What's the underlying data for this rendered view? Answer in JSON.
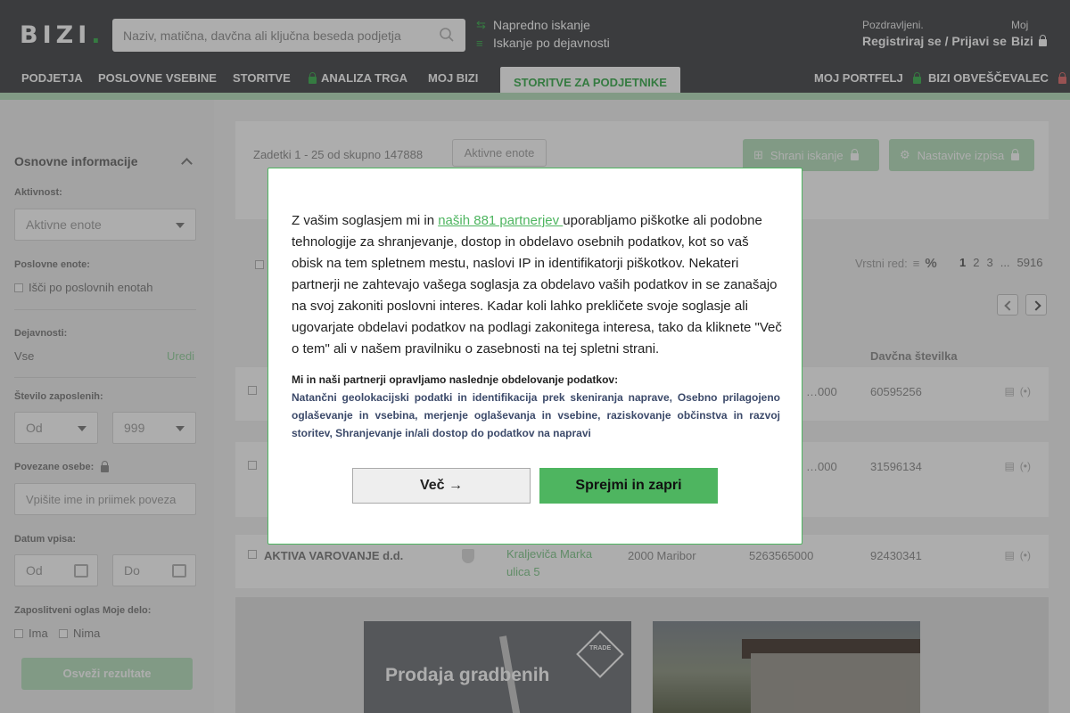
{
  "header": {
    "logo": "BIZI",
    "search_placeholder": "Naziv, matična, davčna ali ključna beseda podjetja",
    "advanced_search": "Napredno iskanje",
    "activity_search": "Iskanje po dejavnosti",
    "greeting": "Pozdravljeni.",
    "login": "Registriraj se / Prijavi se",
    "moj_small": "Moj",
    "moj_big": "Bizi"
  },
  "nav": {
    "items": [
      "PODJETJA",
      "POSLOVNE VSEBINE",
      "STORITVE",
      "ANALIZA TRGA",
      "MOJ BIZI",
      "STORITVE ZA PODJETNIKE"
    ],
    "right": [
      "MOJ PORTFELJ",
      "BIZI OBVEŠČEVALEC"
    ]
  },
  "sidebar": {
    "title": "Osnovne informacije",
    "aktivnost_label": "Aktivnost:",
    "aktivnost_value": "Aktivne enote",
    "poslovne_label": "Poslovne enote:",
    "poslovne_cb": "Išči po poslovnih enotah",
    "dejavnosti_label": "Dejavnosti:",
    "dejavnosti_value": "Vse",
    "dejavnosti_edit": "Uredi",
    "zaposleni_label": "Število zaposlenih:",
    "od": "Od",
    "do_value": "999",
    "osebe_label": "Povezane osebe:",
    "osebe_placeholder": "Vpišite ime in priimek poveza",
    "datum_label": "Datum vpisa:",
    "datum_od": "Od",
    "datum_do": "Do",
    "oglas_label": "Zaposlitveni oglas Moje delo:",
    "ima": "Ima",
    "nima": "Nima",
    "refresh": "Osveži rezultate"
  },
  "main": {
    "hits": "Zadetki 1 - 25 od skupno 147888",
    "active_tag": "Aktivne enote",
    "save_search": "Shrani iskanje",
    "settings": "Nastavitve izpisa",
    "sort_label": "Vrstni red:",
    "sort_icon": "%",
    "pages": [
      "1",
      "2",
      "3",
      "...",
      "5916"
    ],
    "col_tax": "Davčna številka",
    "rows": [
      {
        "name": "",
        "tax": "60595256",
        "reg": "…000"
      },
      {
        "name": "",
        "tax": "31596134",
        "reg": "…000"
      },
      {
        "name": "AKTIVA VAROVANJE d.d.",
        "address": "Kraljeviča Marka ulica 5",
        "post": "2000 Maribor",
        "reg": "5263565000",
        "tax": "92430341"
      }
    ],
    "ad1_title": "Prodaja gradbenih",
    "ad1_badge": "TRADE"
  },
  "consent": {
    "text_before": "Z vašim soglasjem mi in ",
    "link": "naših 881 partnerjev ",
    "text_after": "uporabljamo piškotke ali podobne tehnologije za shranjevanje, dostop in obdelavo osebnih podatkov, kot so vaš obisk na tem spletnem mestu, naslovi IP in identifikatorji piškotkov. Nekateri partnerji ne zahtevajo vašega soglasja za obdelavo vaših podatkov in se zanašajo na svoj zakoniti poslovni interes. Kadar koli lahko prekličete svoje soglasje ali ugovarjate obdelavi podatkov na podlagi zakonitega interesa, tako da kliknete \"Več o tem\" ali v našem pravilniku o zasebnosti na tej spletni strani.",
    "subtitle": "Mi in naši partnerji opravljamo naslednje obdelovanje podatkov:",
    "purposes": "Natančni geolokacijski podatki in identifikacija prek skeniranja naprave, Osebno prilagojeno oglaševanje in vsebina, merjenje oglaševanja in vsebine, raziskovanje občinstva in razvoj storitev, Shranjevanje in/ali dostop do podatkov na napravi",
    "more_button": "Več →",
    "accept_button": "Sprejmi in zapri"
  },
  "colors": {
    "accent": "#4eb560",
    "header": "#57595c"
  }
}
